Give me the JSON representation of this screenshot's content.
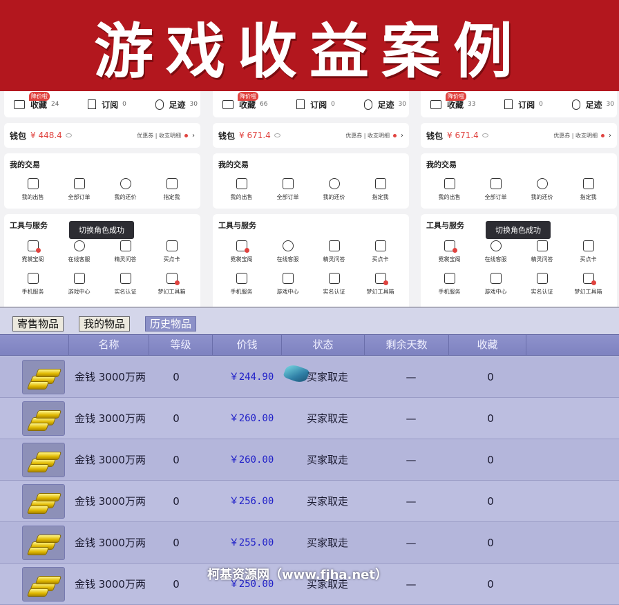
{
  "banner": {
    "title": "游戏收益案例"
  },
  "panels": [
    {
      "stats": [
        {
          "label": "收藏",
          "count": "24",
          "tag": "降价啦"
        },
        {
          "label": "订阅",
          "count": "0"
        },
        {
          "label": "足迹",
          "count": "30"
        }
      ],
      "wallet": {
        "label": "钱包",
        "amount": "¥ 448.4",
        "links": "优惠券 | 收支明细"
      },
      "trade": {
        "title": "我的交易",
        "items": [
          "我的出售",
          "全部订单",
          "我的还价",
          "指定我"
        ]
      },
      "tools": {
        "title": "工具与服务",
        "items": [
          "霓裳宝阁",
          "在线客服",
          "精灵问答",
          "买点卡",
          "手机服务",
          "游戏中心",
          "实名认证",
          "梦幻工具箱"
        ]
      },
      "toast": "切换角色成功"
    },
    {
      "stats": [
        {
          "label": "收藏",
          "count": "66",
          "tag": "降价啦"
        },
        {
          "label": "订阅",
          "count": "0"
        },
        {
          "label": "足迹",
          "count": "30"
        }
      ],
      "wallet": {
        "label": "钱包",
        "amount": "¥ 671.4",
        "links": "优惠券 | 收支明细"
      },
      "trade": {
        "title": "我的交易",
        "items": [
          "我的出售",
          "全部订单",
          "我的还价",
          "指定我"
        ]
      },
      "tools": {
        "title": "工具与服务",
        "items": [
          "霓裳宝阁",
          "在线客服",
          "精灵问答",
          "买点卡",
          "手机服务",
          "游戏中心",
          "实名认证",
          "梦幻工具箱"
        ]
      },
      "toast": ""
    },
    {
      "stats": [
        {
          "label": "收藏",
          "count": "33",
          "tag": "降价啦"
        },
        {
          "label": "订阅",
          "count": "0"
        },
        {
          "label": "足迹",
          "count": "30"
        }
      ],
      "wallet": {
        "label": "钱包",
        "amount": "¥ 671.4",
        "links": "优惠券 | 收支明细"
      },
      "trade": {
        "title": "我的交易",
        "items": [
          "我的出售",
          "全部订单",
          "我的还价",
          "指定我"
        ]
      },
      "tools": {
        "title": "工具与服务",
        "items": [
          "霓裳宝阁",
          "在线客服",
          "精灵问答",
          "买点卡",
          "手机服务",
          "游戏中心",
          "实名认证",
          "梦幻工具箱"
        ]
      },
      "toast": "切换角色成功"
    }
  ],
  "game": {
    "tabs": [
      "寄售物品",
      "我的物品",
      "历史物品"
    ],
    "active_tab": "历史物品",
    "headers": [
      "名称",
      "等级",
      "价钱",
      "状态",
      "剩余天数",
      "收藏"
    ],
    "rows": [
      {
        "name": "金钱 3000万两",
        "level": "0",
        "price": "￥244.90",
        "status": "买家取走",
        "days": "—",
        "fav": "0"
      },
      {
        "name": "金钱 3000万两",
        "level": "0",
        "price": "￥260.00",
        "status": "买家取走",
        "days": "—",
        "fav": "0"
      },
      {
        "name": "金钱 3000万两",
        "level": "0",
        "price": "￥260.00",
        "status": "买家取走",
        "days": "—",
        "fav": "0"
      },
      {
        "name": "金钱 3000万两",
        "level": "0",
        "price": "￥256.00",
        "status": "买家取走",
        "days": "—",
        "fav": "0"
      },
      {
        "name": "金钱 3000万两",
        "level": "0",
        "price": "￥255.00",
        "status": "买家取走",
        "days": "—",
        "fav": "0"
      },
      {
        "name": "金钱 3000万两",
        "level": "0",
        "price": "￥250.00",
        "status": "买家取走",
        "days": "—",
        "fav": "0"
      }
    ]
  },
  "watermark": "柯基资源网（www.fjha.net）",
  "colors": {
    "banner_red": "#b3171e",
    "price_red": "#e0433f",
    "price_blue": "#2020c8"
  }
}
